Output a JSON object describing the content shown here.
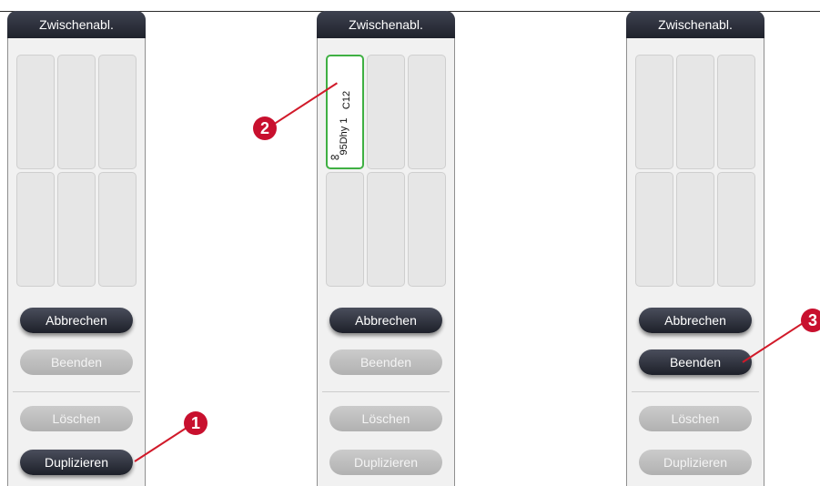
{
  "panel_title": "Zwischenabl.",
  "buttons": {
    "abbrechen": "Abbrechen",
    "beenden": "Beenden",
    "loeschen": "Löschen",
    "duplizieren": "Duplizieren"
  },
  "cassette": {
    "id": "C12",
    "reagent": "95Dhy 1",
    "infinity": "∞"
  },
  "callouts": [
    "1",
    "2",
    "3"
  ],
  "colors": {
    "header_dark": "#1f222c",
    "selected_border": "#3fb043",
    "callout_red": "#c8102e"
  }
}
